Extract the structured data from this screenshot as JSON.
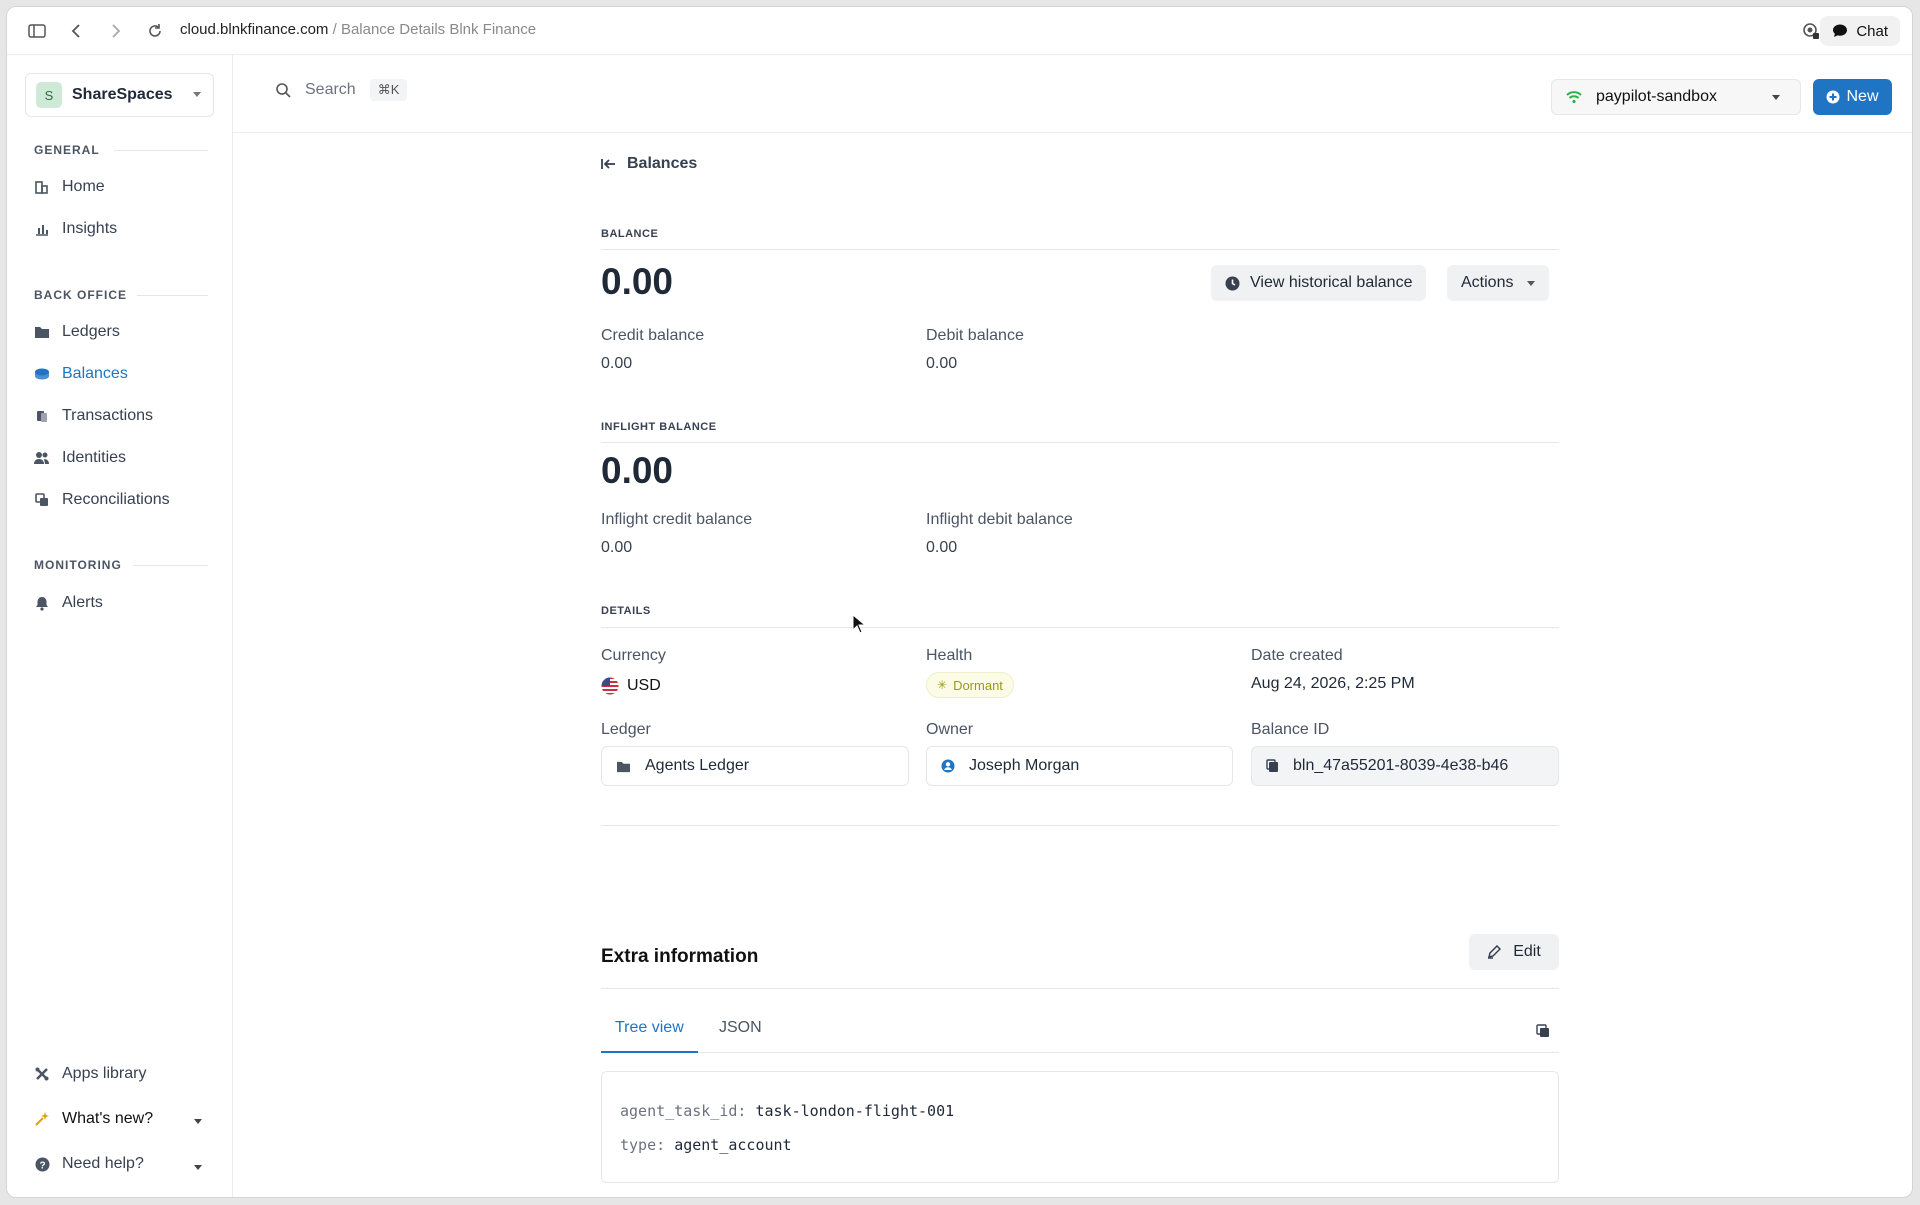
{
  "browser": {
    "url_domain": "cloud.blnkfinance.com",
    "url_sep": " / ",
    "url_title": "Balance Details Blnk Finance",
    "chat_label": "Chat"
  },
  "sidebar": {
    "workspace_initial": "S",
    "workspace_name": "ShareSpaces",
    "sections": {
      "general": "GENERAL",
      "back_office": "BACK OFFICE",
      "monitoring": "MONITORING"
    },
    "items": {
      "home": "Home",
      "insights": "Insights",
      "ledgers": "Ledgers",
      "balances": "Balances",
      "transactions": "Transactions",
      "identities": "Identities",
      "reconciliations": "Reconciliations",
      "alerts": "Alerts",
      "apps_library": "Apps library",
      "whats_new": "What's new?",
      "need_help": "Need help?"
    }
  },
  "header": {
    "search_label": "Search",
    "search_shortcut": "⌘K",
    "environment": "paypilot-sandbox",
    "new_label": "New",
    "accent": "#1f74c4"
  },
  "page": {
    "back_label": "Balances",
    "balance": {
      "caption": "BALANCE",
      "value": "0.00",
      "view_historical": "View historical balance",
      "actions": "Actions",
      "credit_label": "Credit balance",
      "credit_value": "0.00",
      "debit_label": "Debit balance",
      "debit_value": "0.00"
    },
    "inflight": {
      "caption": "INFLIGHT BALANCE",
      "value": "0.00",
      "credit_label": "Inflight credit balance",
      "credit_value": "0.00",
      "debit_label": "Inflight debit balance",
      "debit_value": "0.00"
    },
    "details": {
      "caption": "DETAILS",
      "currency_label": "Currency",
      "currency_value": "USD",
      "health_label": "Health",
      "health_value": "Dormant",
      "date_label": "Date created",
      "date_value": "Aug 24, 2026, 2:25 PM",
      "ledger_label": "Ledger",
      "ledger_value": "Agents Ledger",
      "owner_label": "Owner",
      "owner_value": "Joseph Morgan",
      "balance_id_label": "Balance ID",
      "balance_id_value": "bln_47a55201-8039-4e38-b46"
    },
    "extra": {
      "title": "Extra information",
      "edit_label": "Edit",
      "tabs": [
        "Tree view",
        "JSON"
      ],
      "entries": [
        {
          "key": "agent_task_id:",
          "value": "task-london-flight-001"
        },
        {
          "key": "type:",
          "value": "agent_account"
        }
      ]
    }
  }
}
